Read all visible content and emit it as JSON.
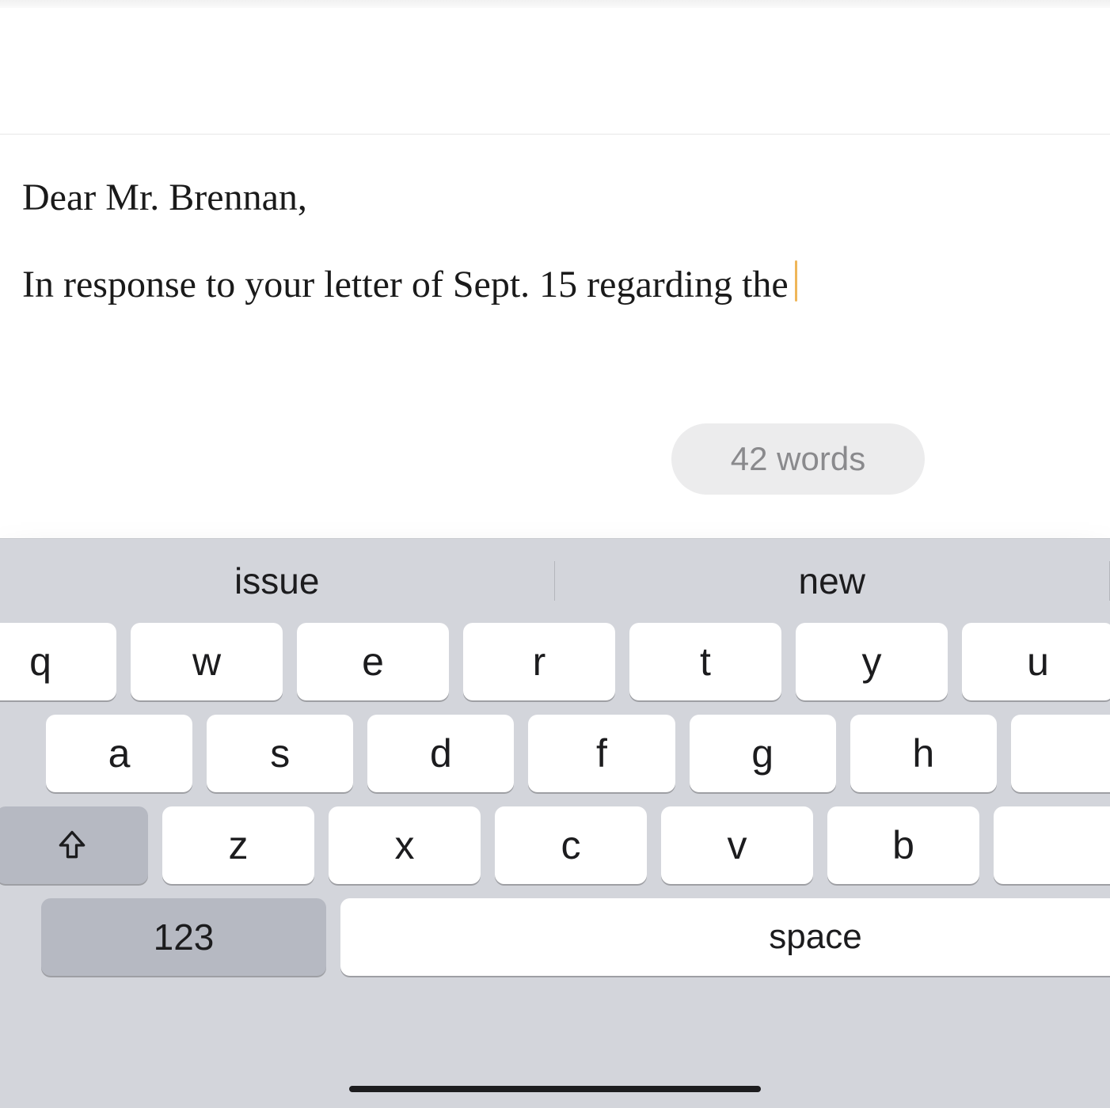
{
  "editor": {
    "line1": "Dear Mr. Brennan,",
    "line2": "In response to your letter of Sept. 15 regarding the"
  },
  "wordcount": {
    "label": "42 words"
  },
  "suggestions": {
    "left": "issue",
    "right": "new"
  },
  "keyboard": {
    "row1": [
      "q",
      "w",
      "e",
      "r",
      "t",
      "y",
      "u"
    ],
    "row2": [
      "a",
      "s",
      "d",
      "f",
      "g",
      "h"
    ],
    "row3": [
      "z",
      "x",
      "c",
      "v",
      "b"
    ],
    "numeric_label": "123",
    "space_label": "space"
  }
}
